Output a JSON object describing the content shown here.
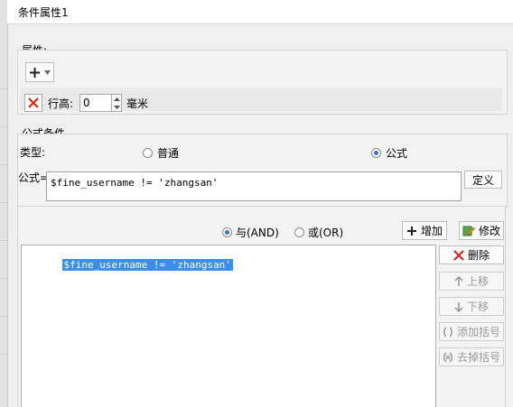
{
  "window": {
    "title": "条件属性1"
  },
  "properties": {
    "section_label": "属性:",
    "row_height_label": "行高:",
    "row_height_value": "0",
    "unit_label": "毫米"
  },
  "formula": {
    "section_label": "公式条件",
    "type_label": "类型:",
    "type_options": [
      "普通",
      "公式"
    ],
    "type_selected": "公式",
    "formula_label": "公式=",
    "formula_value": "$fine_username != 'zhangsan'",
    "define_button": "定义"
  },
  "logic": {
    "and_label": "与(AND)",
    "or_label": "或(OR)",
    "selected": "与(AND)",
    "add_button": "增加",
    "edit_button": "修改"
  },
  "conditions": {
    "items": [
      "$fine_username != 'zhangsan'"
    ],
    "delete_button": "删除",
    "move_up_button": "上移",
    "move_down_button": "下移",
    "add_bracket_button": "添加括号",
    "remove_bracket_button": "去掉括号"
  },
  "colors": {
    "selection": "#3b8fe8",
    "delete_red": "#d9261c",
    "accent_blue": "#3a73c9"
  }
}
